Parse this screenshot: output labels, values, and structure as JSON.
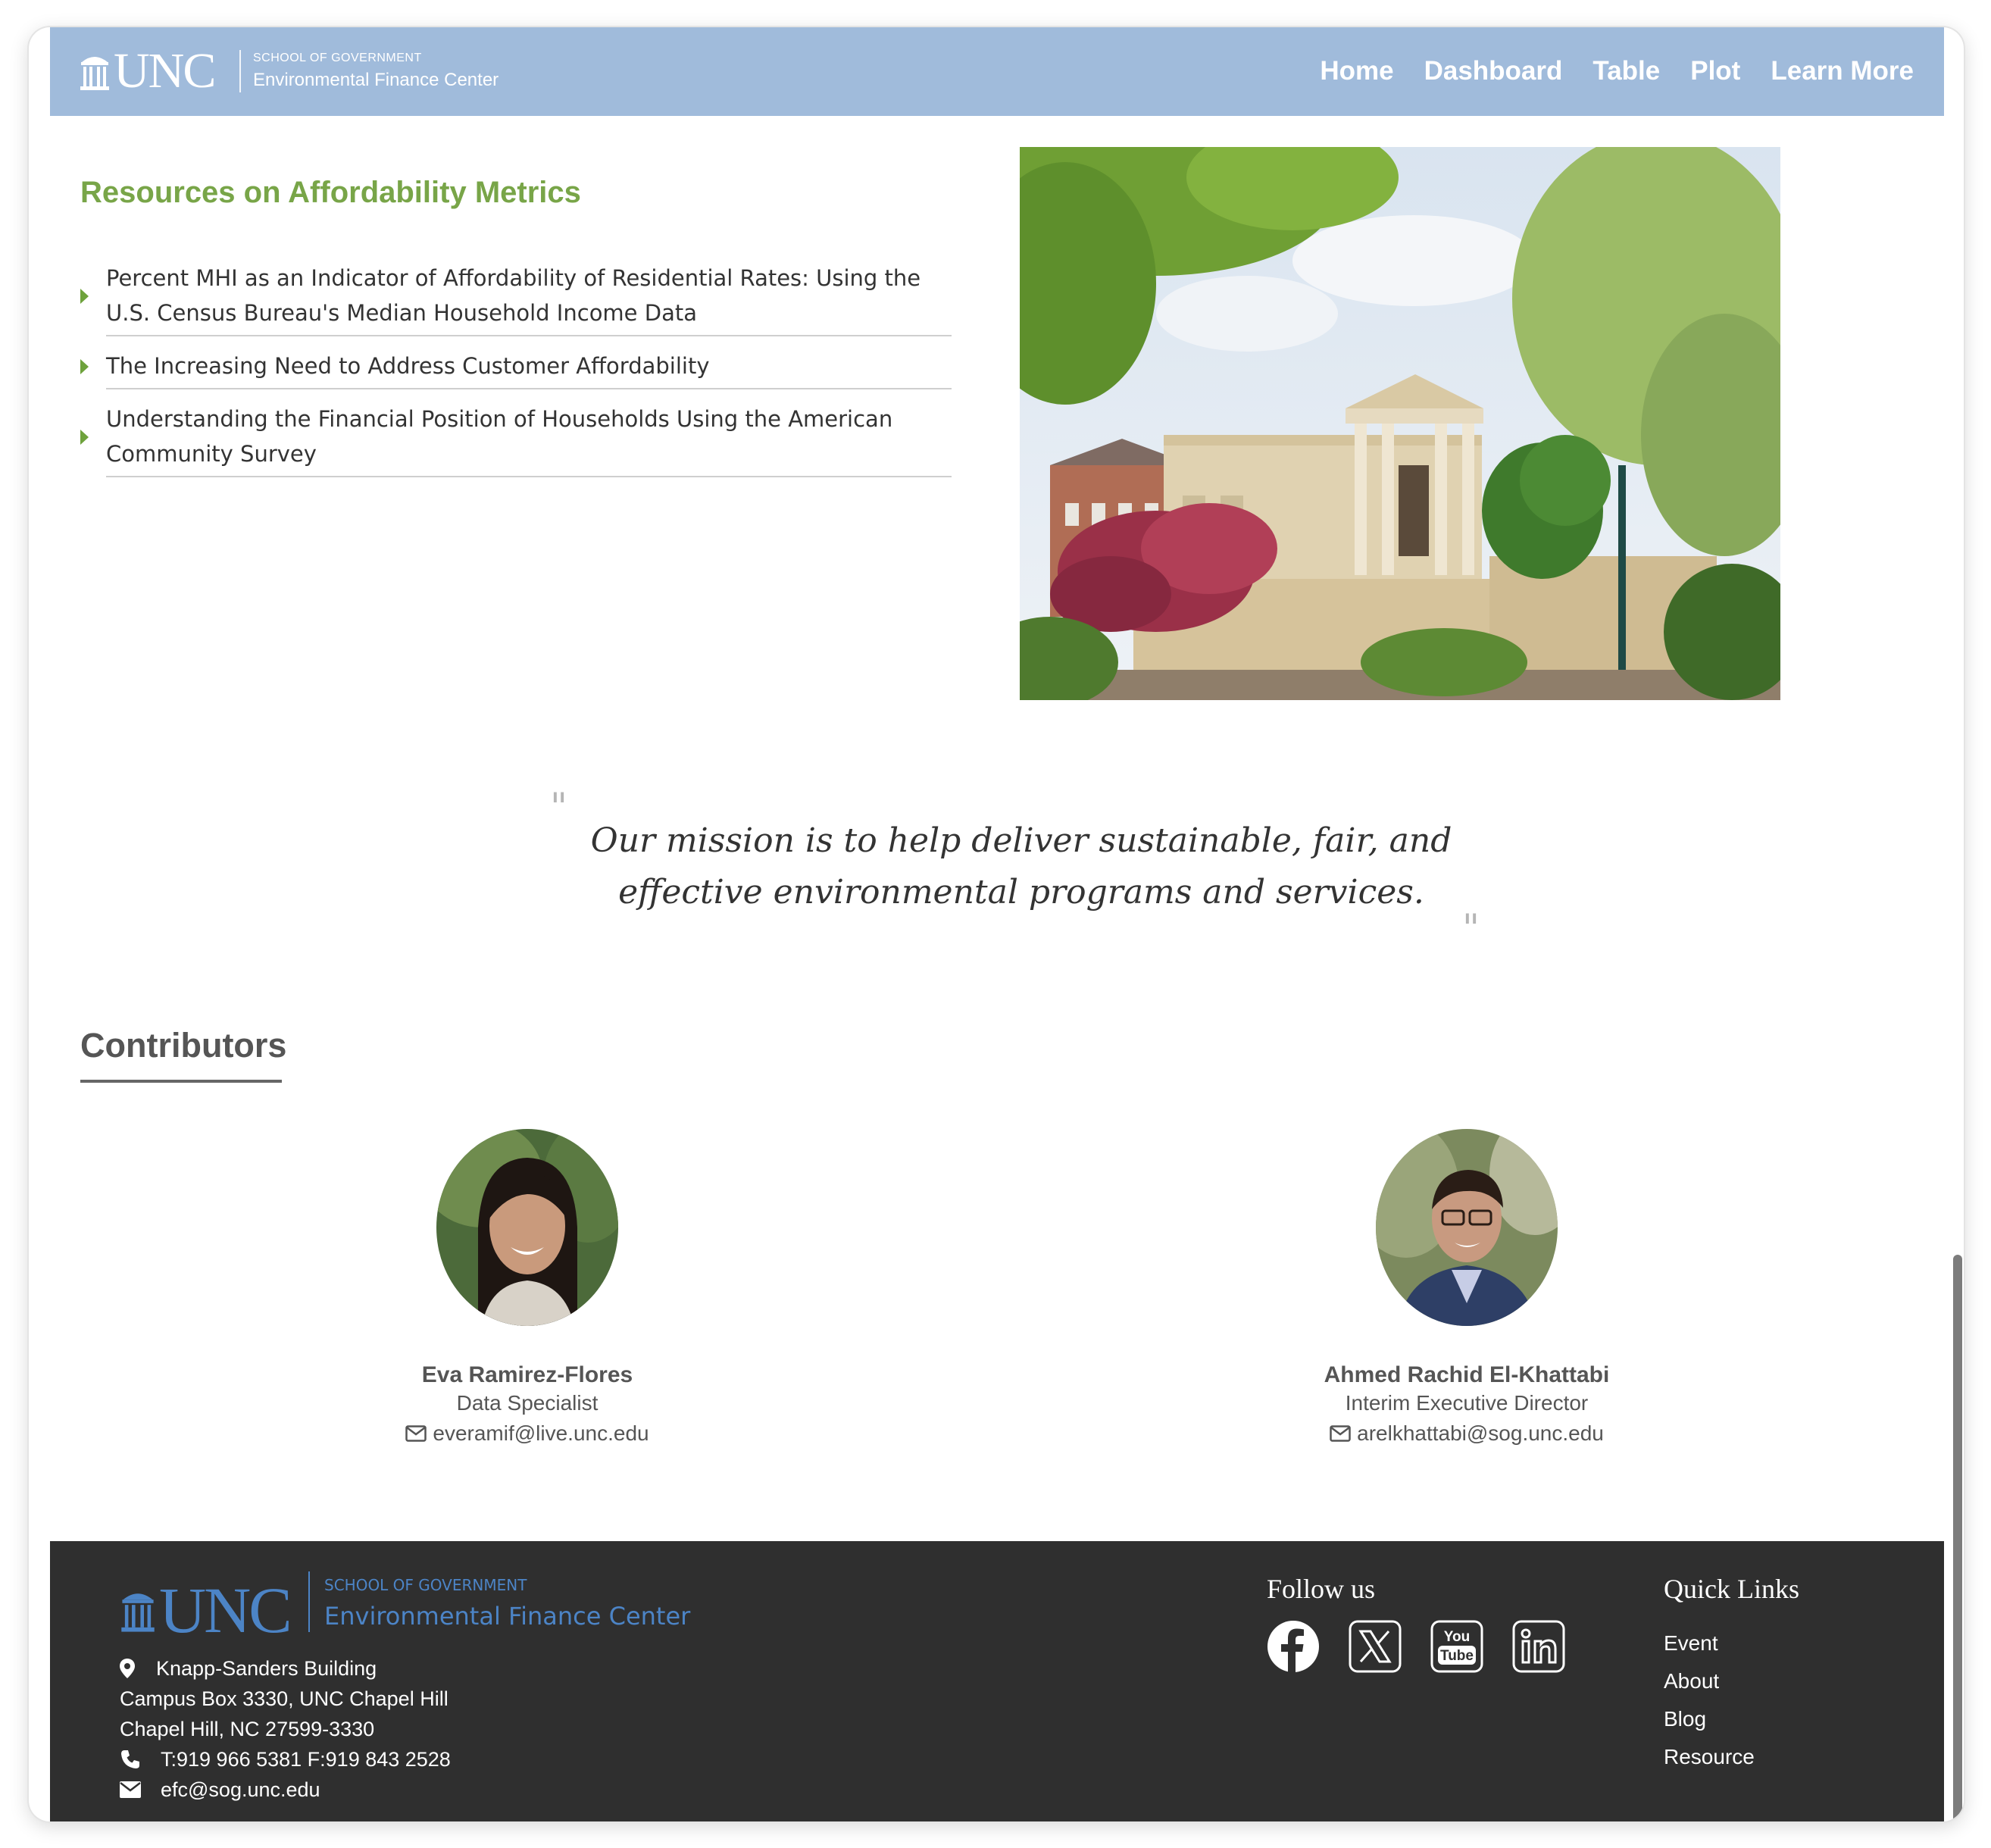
{
  "header": {
    "logo_word": "UNC",
    "logo_subtitle": "SCHOOL OF GOVERNMENT",
    "logo_title": "Environmental Finance Center",
    "nav": [
      {
        "label": "Home"
      },
      {
        "label": "Dashboard"
      },
      {
        "label": "Table"
      },
      {
        "label": "Plot"
      },
      {
        "label": "Learn More"
      }
    ]
  },
  "resources": {
    "title": "Resources on Affordability Metrics",
    "items": [
      {
        "label": "Percent MHI as an Indicator of Affordability of Residential Rates: Using the U.S. Census Bureau's Median Household Income Data"
      },
      {
        "label": "The Increasing Need to Address Customer Affordability"
      },
      {
        "label": "Understanding the Financial Position of Households Using the American Community Survey"
      }
    ]
  },
  "mission": {
    "open_mark": "\"",
    "close_mark": "\"",
    "text": "Our mission is to help deliver sustainable, fair, and effective environmental programs and services."
  },
  "contributors": {
    "title": "Contributors",
    "people": [
      {
        "name": "Eva Ramirez-Flores",
        "role": "Data Specialist",
        "email": "everamif@live.unc.edu"
      },
      {
        "name": "Ahmed Rachid El-Khattabi",
        "role": "Interim Executive Director",
        "email": "arelkhattabi@sog.unc.edu"
      }
    ]
  },
  "footer": {
    "logo_word": "UNC",
    "logo_subtitle": "SCHOOL OF GOVERNMENT",
    "logo_title": "Environmental Finance Center",
    "address": {
      "building": "Knapp-Sanders Building",
      "line2": "Campus Box 3330, UNC Chapel Hill",
      "line3": "Chapel Hill, NC 27599-3330",
      "phone": "T:919 966 5381 F:919 843 2528",
      "email": "efc@sog.unc.edu"
    },
    "follow_title": "Follow us",
    "social_icons": [
      "facebook-icon",
      "x-icon",
      "youtube-icon",
      "linkedin-icon"
    ],
    "youtube_text_top": "You",
    "youtube_text_bottom": "Tube",
    "quick_links_title": "Quick Links",
    "quick_links": [
      {
        "label": "Event"
      },
      {
        "label": "About"
      },
      {
        "label": "Blog"
      },
      {
        "label": "Resource"
      }
    ]
  },
  "colors": {
    "nav_bg": "#a0bbdb",
    "accent_green": "#78a548",
    "footer_bg": "#2f2f2f",
    "footer_logo_blue": "#4c84c6"
  }
}
